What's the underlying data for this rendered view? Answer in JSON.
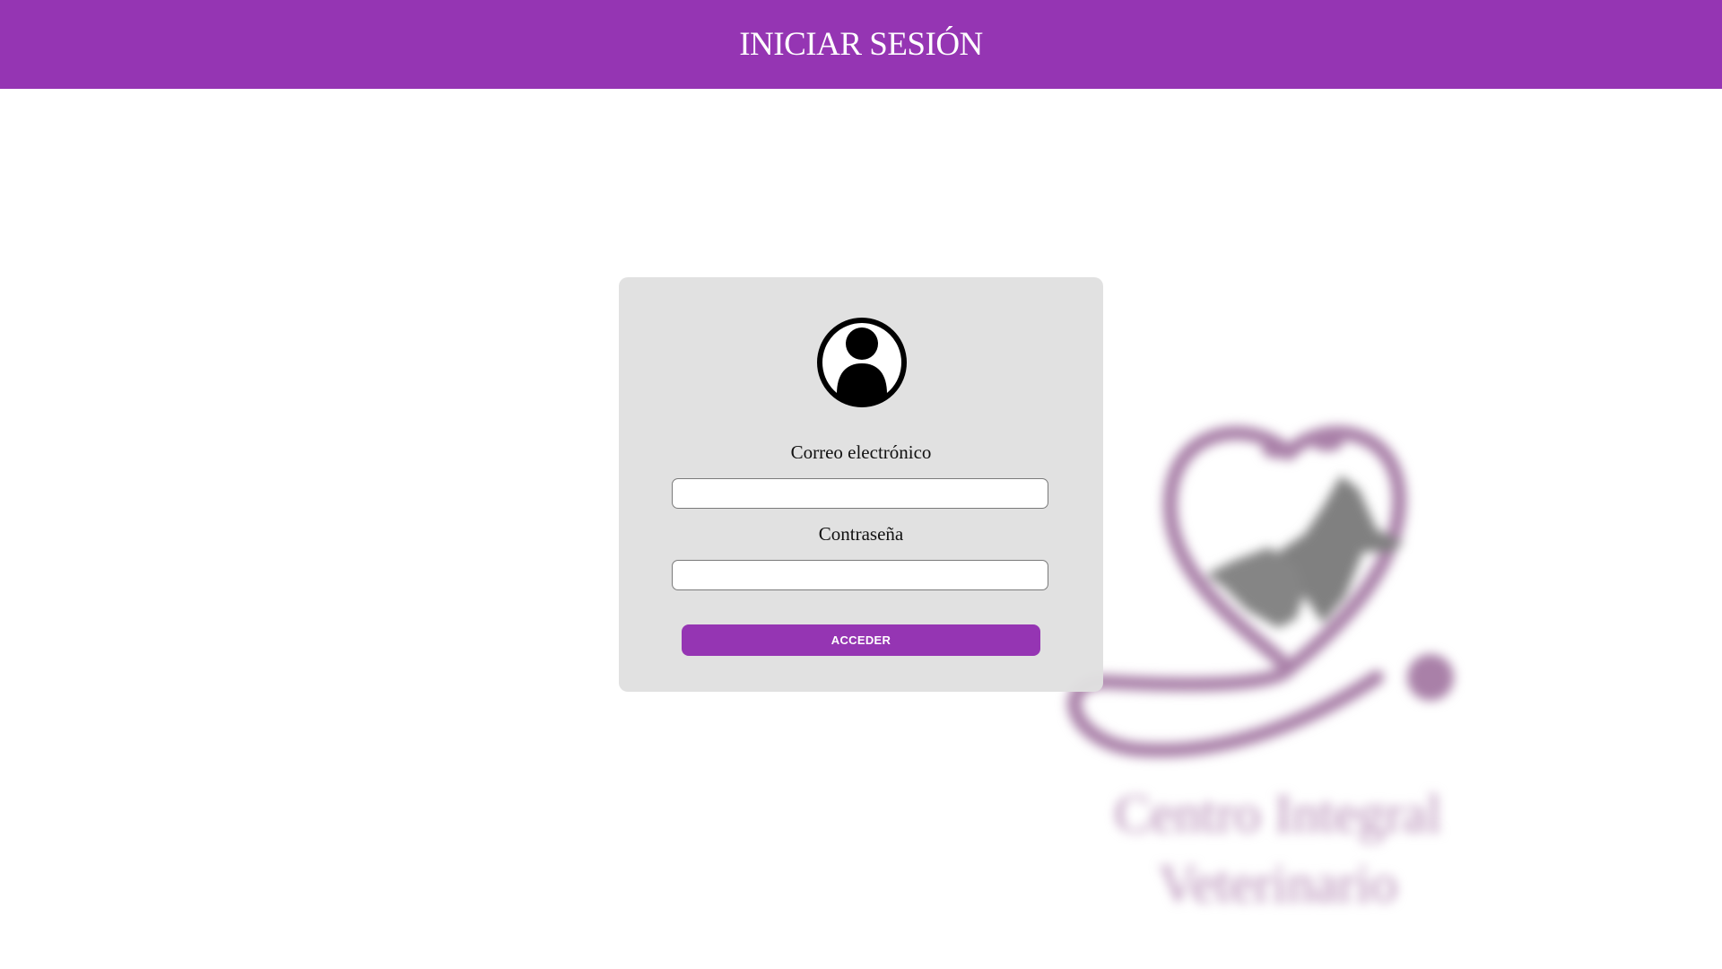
{
  "header": {
    "title": "INICIAR SESIÓN",
    "background": "#9535b3"
  },
  "login_card": {
    "avatar_icon": "user-circle-icon",
    "email_label": "Correo electrónico",
    "email_value": "",
    "password_label": "Contraseña",
    "password_value": "",
    "submit_label": "ACCEDER"
  },
  "watermark": {
    "logo_icon": "heart-stethoscope-dog-cat-logo",
    "line1": "Centro Integral",
    "line2": "Veterinario"
  },
  "colors": {
    "accent": "#9535b3",
    "card_background": "#e0e0e0",
    "watermark": "#b58cb5"
  }
}
